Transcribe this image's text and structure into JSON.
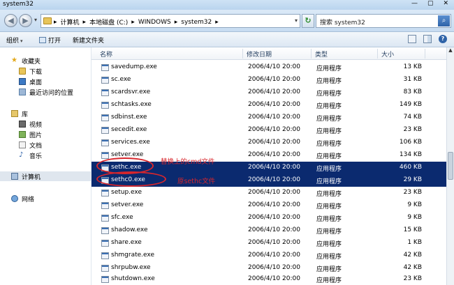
{
  "window": {
    "title": "system32",
    "min": "—",
    "max": "▢",
    "close": "✕"
  },
  "address": {
    "crumbs": [
      "计算机",
      "本地磁盘 (C:)",
      "WINDOWS",
      "system32"
    ],
    "sep": "▸",
    "dropdown": "▾"
  },
  "search": {
    "placeholder": "搜索 system32"
  },
  "toolbar": {
    "organize": "组织",
    "open": "打开",
    "new_folder": "新建文件夹",
    "arrow": "▾"
  },
  "nav": {
    "favorites": "收藏夹",
    "downloads": "下载",
    "desktop": "桌面",
    "recent": "最近访问的位置",
    "library": "库",
    "videos": "视频",
    "pictures": "图片",
    "documents": "文档",
    "music": "音乐",
    "computer": "计算机",
    "network": "网络"
  },
  "columns": {
    "name": "名称",
    "date": "修改日期",
    "type": "类型",
    "size": "大小"
  },
  "files": [
    {
      "name": "savedump.exe",
      "date": "2006/4/10 20:00",
      "type": "应用程序",
      "size": "13 KB"
    },
    {
      "name": "sc.exe",
      "date": "2006/4/10 20:00",
      "type": "应用程序",
      "size": "31 KB"
    },
    {
      "name": "scardsvr.exe",
      "date": "2006/4/10 20:00",
      "type": "应用程序",
      "size": "83 KB"
    },
    {
      "name": "schtasks.exe",
      "date": "2006/4/10 20:00",
      "type": "应用程序",
      "size": "149 KB"
    },
    {
      "name": "sdbinst.exe",
      "date": "2006/4/10 20:00",
      "type": "应用程序",
      "size": "74 KB"
    },
    {
      "name": "secedit.exe",
      "date": "2006/4/10 20:00",
      "type": "应用程序",
      "size": "23 KB"
    },
    {
      "name": "services.exe",
      "date": "2006/4/10 20:00",
      "type": "应用程序",
      "size": "106 KB"
    },
    {
      "name": "setver.exe",
      "date": "2006/4/10 20:00",
      "type": "应用程序",
      "size": "134 KB"
    },
    {
      "name": "sethc.exe",
      "date": "2006/4/10 20:00",
      "type": "应用程序",
      "size": "460 KB"
    },
    {
      "name": "sethc0.exe",
      "date": "2006/4/10 20:00",
      "type": "应用程序",
      "size": "29 KB"
    },
    {
      "name": "setup.exe",
      "date": "2006/4/10 20:00",
      "type": "应用程序",
      "size": "23 KB"
    },
    {
      "name": "setver.exe",
      "date": "2006/4/10 20:00",
      "type": "应用程序",
      "size": "9 KB"
    },
    {
      "name": "sfc.exe",
      "date": "2006/4/10 20:00",
      "type": "应用程序",
      "size": "9 KB"
    },
    {
      "name": "shadow.exe",
      "date": "2006/4/10 20:00",
      "type": "应用程序",
      "size": "15 KB"
    },
    {
      "name": "share.exe",
      "date": "2006/4/10 20:00",
      "type": "应用程序",
      "size": "1 KB"
    },
    {
      "name": "shmgrate.exe",
      "date": "2006/4/10 20:00",
      "type": "应用程序",
      "size": "42 KB"
    },
    {
      "name": "shrpubw.exe",
      "date": "2006/4/10 20:00",
      "type": "应用程序",
      "size": "42 KB"
    },
    {
      "name": "shutdown.exe",
      "date": "2006/4/10 20:00",
      "type": "应用程序",
      "size": "23 KB"
    }
  ],
  "annotations": {
    "replaced": "替换上的cmd文件",
    "original": "原sethc文件"
  },
  "colors": {
    "selection": "#0b2a6f",
    "annotation": "#d8262c"
  }
}
